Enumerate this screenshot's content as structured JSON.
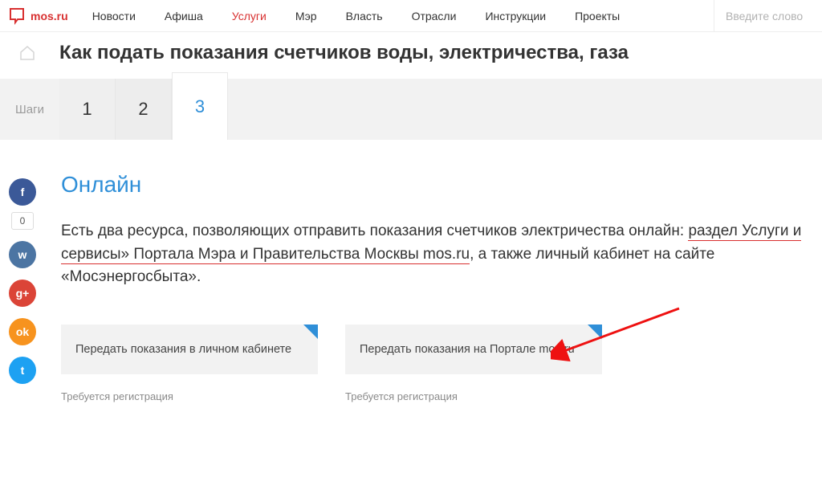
{
  "logo": {
    "text": "mos.ru"
  },
  "nav": {
    "items": [
      {
        "label": "Новости"
      },
      {
        "label": "Афиша"
      },
      {
        "label": "Услуги",
        "active": true
      },
      {
        "label": "Мэр"
      },
      {
        "label": "Власть"
      },
      {
        "label": "Отрасли"
      },
      {
        "label": "Инструкции"
      },
      {
        "label": "Проекты"
      }
    ]
  },
  "search": {
    "placeholder": "Введите слово"
  },
  "page_title": "Как подать показания счетчиков воды, электричества, газа",
  "steps": {
    "label": "Шаги",
    "items": [
      "1",
      "2",
      "3"
    ],
    "active_index": 2
  },
  "share": {
    "count": "0",
    "buttons": [
      {
        "id": "fb",
        "glyph": "f"
      },
      {
        "id": "vk",
        "glyph": "w"
      },
      {
        "id": "gp",
        "glyph": "g+"
      },
      {
        "id": "ok",
        "glyph": "ok"
      },
      {
        "id": "tw",
        "glyph": "t"
      }
    ]
  },
  "section": {
    "heading": "Онлайн",
    "text_pre": "Есть два ресурса, позволяющих отправить показания счетчиков электричества онлайн: ",
    "link_text": "раздел Услуги и сервисы» Портала Мэра и Правительства Москвы mos.ru",
    "text_post": ", а также личный кабинет на сайте «Мосэнергосбыта»."
  },
  "cards": [
    {
      "label": "Передать показания в личном кабинете",
      "sub": "Требуется регистрация"
    },
    {
      "label": "Передать показания на Портале mos.ru",
      "sub": "Требуется регистрация"
    }
  ]
}
